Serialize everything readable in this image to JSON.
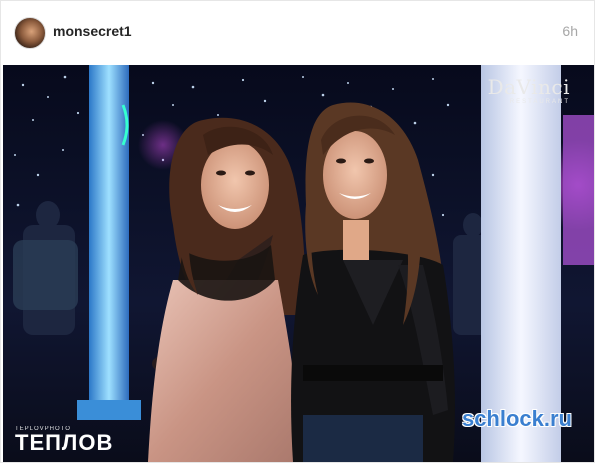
{
  "post": {
    "username": "monsecret1",
    "time_ago": "6h",
    "avatar_icon": "user-avatar"
  },
  "photo": {
    "brand_watermark": "DaVinci",
    "brand_watermark_sub": "RESTAURANT",
    "photographer_watermark_top": "TEPLOVPHOTO",
    "photographer_watermark": "ТЕПЛОВ",
    "site_watermark": "schlock.ru"
  },
  "colors": {
    "background_dark": "#0a0d22",
    "accent_blue_light": "#6fd6ff",
    "dress_pink": "#d9a99a",
    "leather_black": "#111111"
  }
}
